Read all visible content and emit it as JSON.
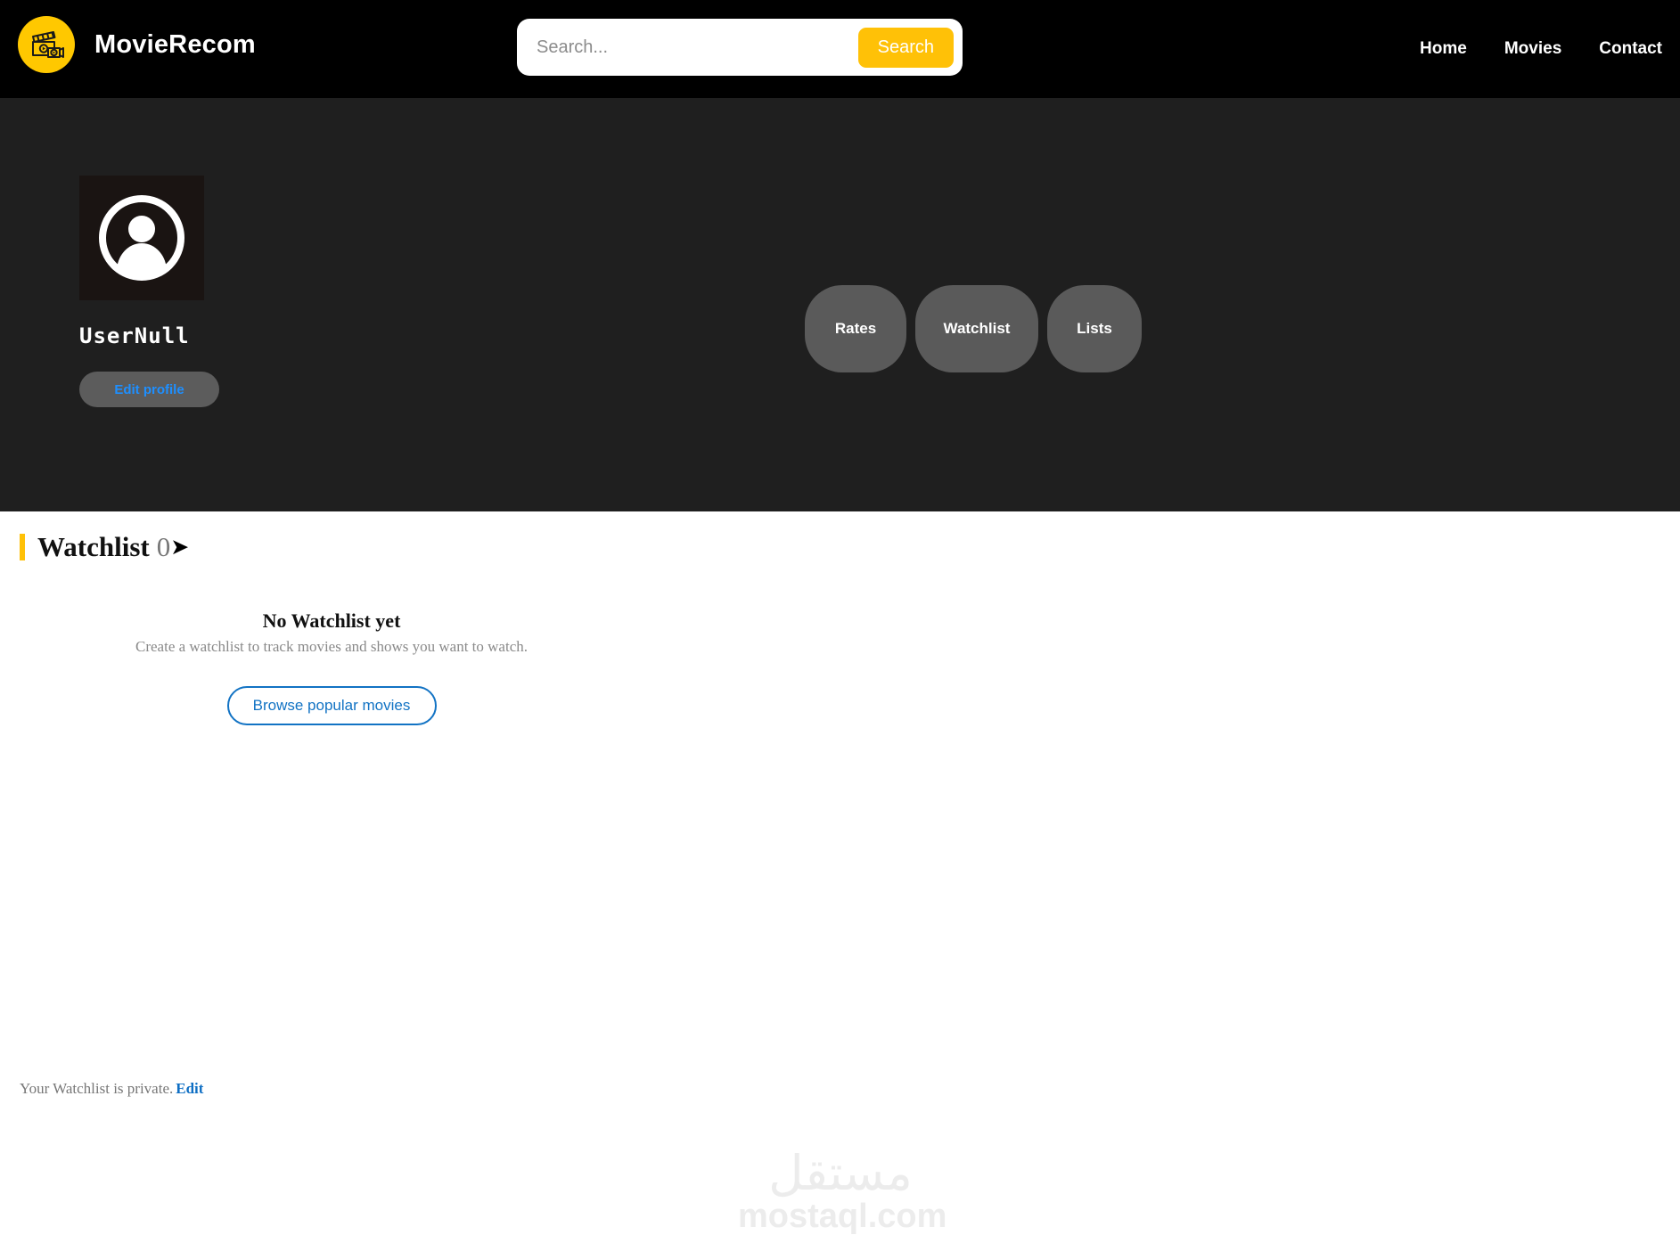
{
  "header": {
    "brand_name": "MovieRecom",
    "logo_icon": "clapperboard-camera-icon",
    "logo_bg": "#FFC800",
    "background": "#000000",
    "search": {
      "placeholder": "Search...",
      "value": "",
      "button_label": "Search",
      "button_color": "#FFC107"
    },
    "nav": [
      {
        "label": "Home"
      },
      {
        "label": "Movies"
      },
      {
        "label": "Contact"
      }
    ]
  },
  "profile": {
    "background": "#1f1f1f",
    "avatar_icon": "user-avatar-icon",
    "username": "UserNull",
    "edit_profile_label": "Edit profile",
    "edit_profile_text_color": "#1e8fff",
    "stats": [
      {
        "label": "Rates"
      },
      {
        "label": "Watchlist"
      },
      {
        "label": "Lists"
      }
    ]
  },
  "watchlist": {
    "accent_color": "#FFC107",
    "title": "Watchlist",
    "count": "0",
    "arrow_glyph": "➤",
    "privacy_text": "Your Watchlist is private.",
    "privacy_edit_label": "Edit",
    "empty_title": "No Watchlist yet",
    "empty_subtitle": "Create a watchlist to track movies and shows you want to watch.",
    "browse_button_label": "Browse popular movies",
    "browse_button_color": "#1273c4"
  },
  "watermark": {
    "arabic": "مستقل",
    "latin": "mostaql.com"
  }
}
